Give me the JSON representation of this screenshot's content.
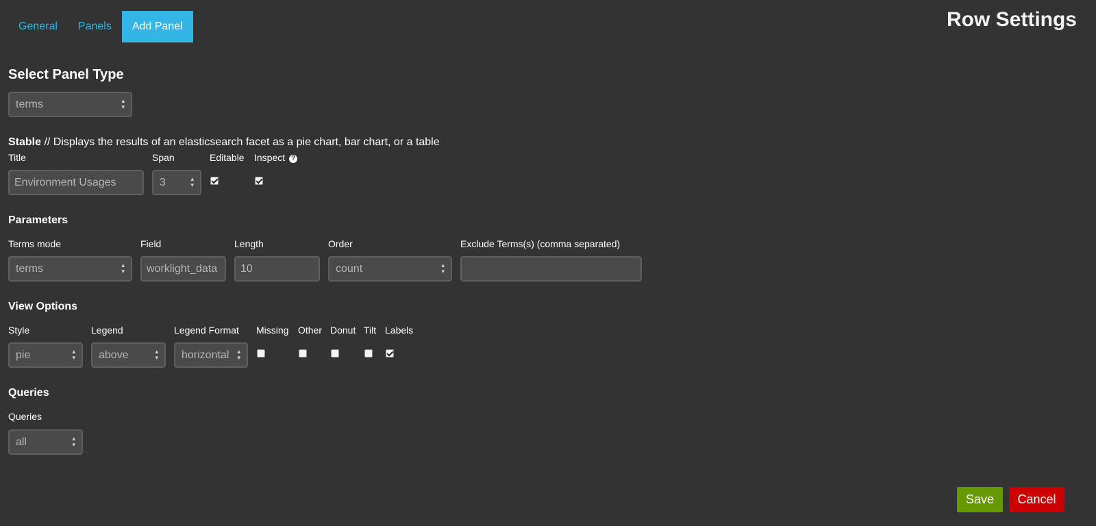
{
  "header": {
    "title": "Row Settings",
    "tabs": [
      {
        "label": "General",
        "active": false
      },
      {
        "label": "Panels",
        "active": false
      },
      {
        "label": "Add Panel",
        "active": true
      }
    ]
  },
  "panel_type": {
    "heading": "Select Panel Type",
    "selected": "terms"
  },
  "description": {
    "status": "Stable",
    "text": " // Displays the results of an elasticsearch facet as a pie chart, bar chart, or a table"
  },
  "general": {
    "title_label": "Title",
    "title_value": "Environment Usages",
    "span_label": "Span",
    "span_value": "3",
    "editable_label": "Editable",
    "editable_checked": true,
    "inspect_label": "Inspect",
    "inspect_checked": true,
    "help_icon": "question-circle-icon"
  },
  "parameters": {
    "heading": "Parameters",
    "terms_mode_label": "Terms mode",
    "terms_mode_value": "terms",
    "field_label": "Field",
    "field_value": "worklight_data",
    "length_label": "Length",
    "length_value": "10",
    "order_label": "Order",
    "order_value": "count",
    "exclude_label": "Exclude Terms(s) (comma separated)",
    "exclude_value": ""
  },
  "view_options": {
    "heading": "View Options",
    "style_label": "Style",
    "style_value": "pie",
    "legend_label": "Legend",
    "legend_value": "above",
    "legend_format_label": "Legend Format",
    "legend_format_value": "horizontal",
    "missing_label": "Missing",
    "missing_checked": false,
    "other_label": "Other",
    "other_checked": false,
    "donut_label": "Donut",
    "donut_checked": false,
    "tilt_label": "Tilt",
    "tilt_checked": false,
    "labels_label": "Labels",
    "labels_checked": true
  },
  "queries": {
    "heading": "Queries",
    "label": "Queries",
    "value": "all"
  },
  "footer": {
    "save_label": "Save",
    "cancel_label": "Cancel",
    "save_color": "#669900",
    "cancel_color": "#cc0000"
  },
  "colors": {
    "background": "#333333",
    "accent": "#33b5e5"
  }
}
